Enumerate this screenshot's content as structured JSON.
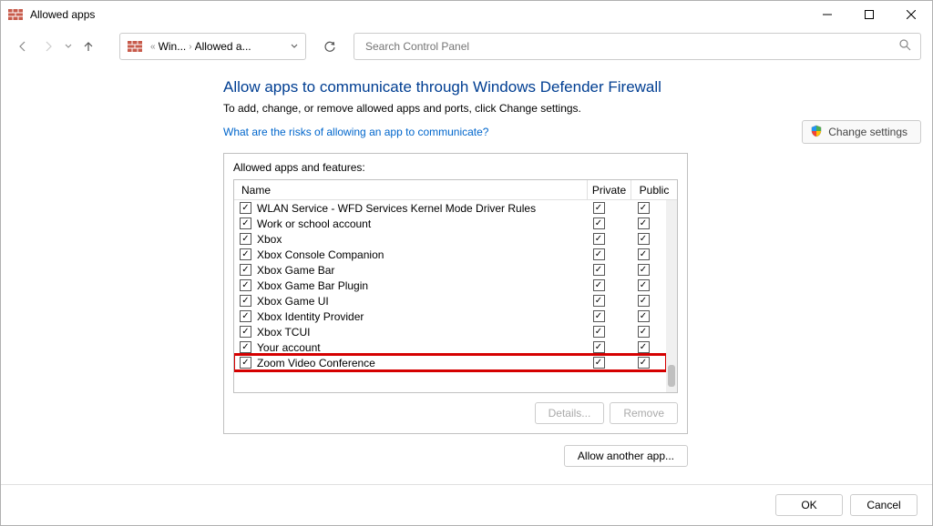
{
  "window": {
    "title": "Allowed apps"
  },
  "breadcrumb": {
    "part1": "Win...",
    "part2": "Allowed a..."
  },
  "search": {
    "placeholder": "Search Control Panel"
  },
  "page": {
    "title": "Allow apps to communicate through Windows Defender Firewall",
    "desc": "To add, change, or remove allowed apps and ports, click Change settings.",
    "risk_link": "What are the risks of allowing an app to communicate?",
    "change_settings": "Change settings"
  },
  "panel": {
    "title": "Allowed apps and features:",
    "col_name": "Name",
    "col_private": "Private",
    "col_public": "Public",
    "details": "Details...",
    "remove": "Remove",
    "allow_another": "Allow another app..."
  },
  "rows": [
    {
      "checked": true,
      "name": "WLAN Service - WFD Services Kernel Mode Driver Rules",
      "private": true,
      "public": true,
      "highlight": false
    },
    {
      "checked": true,
      "name": "Work or school account",
      "private": true,
      "public": true,
      "highlight": false
    },
    {
      "checked": true,
      "name": "Xbox",
      "private": true,
      "public": true,
      "highlight": false
    },
    {
      "checked": true,
      "name": "Xbox Console Companion",
      "private": true,
      "public": true,
      "highlight": false
    },
    {
      "checked": true,
      "name": "Xbox Game Bar",
      "private": true,
      "public": true,
      "highlight": false
    },
    {
      "checked": true,
      "name": "Xbox Game Bar Plugin",
      "private": true,
      "public": true,
      "highlight": false
    },
    {
      "checked": true,
      "name": "Xbox Game UI",
      "private": true,
      "public": true,
      "highlight": false
    },
    {
      "checked": true,
      "name": "Xbox Identity Provider",
      "private": true,
      "public": true,
      "highlight": false
    },
    {
      "checked": true,
      "name": "Xbox TCUI",
      "private": true,
      "public": true,
      "highlight": false
    },
    {
      "checked": true,
      "name": "Your account",
      "private": true,
      "public": true,
      "highlight": false
    },
    {
      "checked": true,
      "name": "Zoom Video Conference",
      "private": true,
      "public": true,
      "highlight": true
    }
  ],
  "footer": {
    "ok": "OK",
    "cancel": "Cancel"
  }
}
